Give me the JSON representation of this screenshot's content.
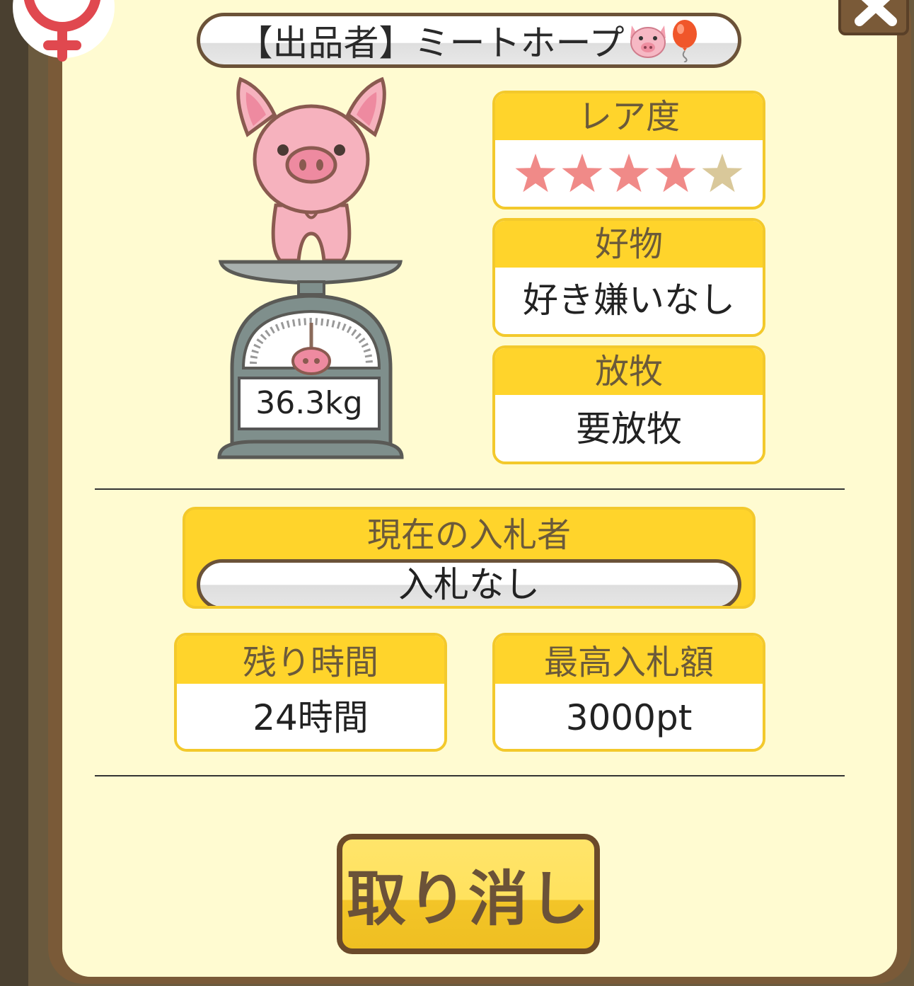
{
  "seller": {
    "label": "【出品者】ミートホープ",
    "icons": [
      "pig-face-icon",
      "balloon-icon"
    ]
  },
  "pig": {
    "weight": "36.3kg"
  },
  "rarity": {
    "label": "レア度",
    "stars_filled": 4,
    "stars_total": 5,
    "filled_color": "#f08a88",
    "empty_color": "#d9c89a"
  },
  "favorite": {
    "label": "好物",
    "value": "好き嫌いなし"
  },
  "grazing": {
    "label": "放牧",
    "value": "要放牧"
  },
  "bidder": {
    "label": "現在の入札者",
    "value": "入札なし"
  },
  "remaining": {
    "label": "残り時間",
    "value": "24時間"
  },
  "top_bid": {
    "label": "最高入札額",
    "value": "3000pt"
  },
  "cancel": {
    "label": "取り消し"
  },
  "colors": {
    "panel_bg": "#fffbd1",
    "header_yellow": "#ffd42b",
    "frame_brown": "#7a5a38"
  }
}
